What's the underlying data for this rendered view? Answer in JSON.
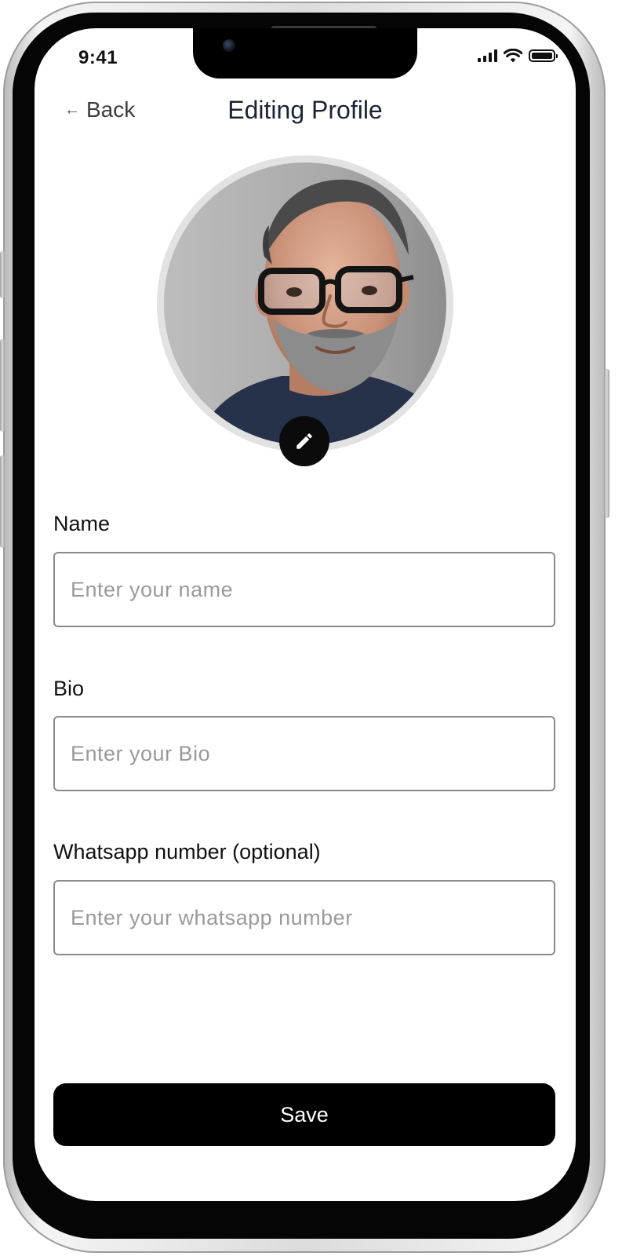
{
  "status_bar": {
    "time": "9:41"
  },
  "header": {
    "back_label": "Back",
    "title": "Editing Profile"
  },
  "form": {
    "name_label": "Name",
    "name_placeholder": "Enter your name",
    "name_value": "",
    "bio_label": "Bio",
    "bio_placeholder": "Enter your Bio",
    "bio_value": "",
    "whatsapp_label": "Whatsapp number (optional)",
    "whatsapp_placeholder": "Enter your whatsapp number",
    "whatsapp_value": ""
  },
  "actions": {
    "save_label": "Save"
  },
  "icons": {
    "back": "arrow-left-icon",
    "edit": "pencil-icon",
    "signal": "cellular-signal-icon",
    "wifi": "wifi-icon",
    "battery": "battery-icon"
  },
  "colors": {
    "title": "#1b2436",
    "primary_button": "#000000",
    "input_border": "#8a8a8a",
    "placeholder": "#9a9a9a"
  }
}
